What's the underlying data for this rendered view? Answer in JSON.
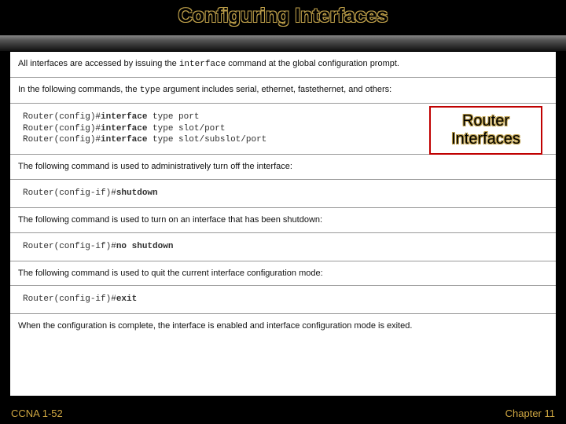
{
  "title": "Configuring Interfaces",
  "callout": "Router Interfaces",
  "rows": {
    "intro": {
      "prefix": "All interfaces are accessed by issuing the ",
      "cmd": "interface",
      "suffix": " command at the global configuration prompt."
    },
    "type_args": {
      "prefix": "In the following commands, the ",
      "cmd": "type",
      "suffix": " argument includes serial, ethernet, fastethernet, and others:"
    },
    "code_block1": {
      "l1_prompt": "Router(config)#",
      "l1_bold": "interface",
      "l1_rest": " type port",
      "l2_prompt": "Router(config)#",
      "l2_bold": "interface",
      "l2_rest": " type slot/port",
      "l3_prompt": "Router(config)#",
      "l3_bold": "interface",
      "l3_rest": " type slot/subslot/port"
    },
    "shutdown_intro": "The following command is used to administratively turn off the interface:",
    "code_shutdown": {
      "prompt": "Router(config-if)#",
      "bold": "shutdown"
    },
    "noshut_intro": "The following command is used to turn on an interface that has been shutdown:",
    "code_noshut": {
      "prompt": "Router(config-if)#",
      "bold": "no shutdown"
    },
    "exit_intro": "The following command is used to quit the current interface configuration mode:",
    "code_exit": {
      "prompt": "Router(config-if)#",
      "bold": "exit"
    },
    "final": "When the configuration is complete, the interface is enabled and interface configuration mode is exited."
  },
  "footer": {
    "left": "CCNA 1-52",
    "right": "Chapter 11"
  }
}
